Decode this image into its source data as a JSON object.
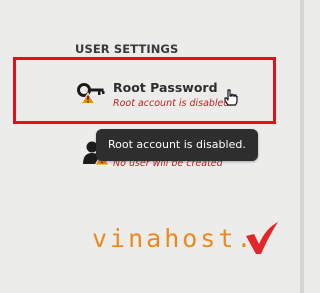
{
  "user_settings": {
    "heading": "USER SETTINGS"
  },
  "root_password": {
    "title": "Root Password",
    "status": "Root account is disabled."
  },
  "tooltip": {
    "text": "Root account is disabled."
  },
  "user_creation": {
    "status": "No user will be created"
  },
  "watermark": {
    "text": "vinahost."
  },
  "colors": {
    "highlight_border": "#e0101c",
    "error_text": "#c2231f",
    "tooltip_bg": "#2e2e2e",
    "watermark_orange": "#ee8a1d",
    "watermark_red": "#e3262a",
    "warning_badge": "#f08c00"
  },
  "icons": {
    "root_password": "key-icon",
    "warning": "warning-icon",
    "user_creation": "user-icon",
    "cursor": "hand-pointer-icon"
  }
}
